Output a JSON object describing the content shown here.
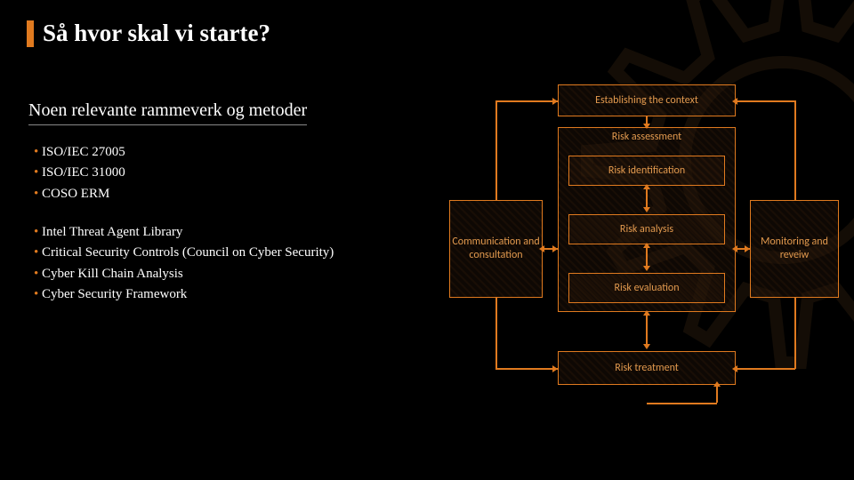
{
  "title": "Så hvor skal vi starte?",
  "subtitle": "Noen relevante rammeverk og metoder",
  "list1": [
    "ISO/IEC 27005",
    "ISO/IEC 31000",
    "COSO ERM"
  ],
  "list2": [
    "Intel Threat Agent Library",
    "Critical Security Controls (Council on Cyber Security)",
    "Cyber Kill Chain Analysis",
    "Cyber Security Framework"
  ],
  "diagram": {
    "comm": "Communication and consultation",
    "mon": "Monitoring and reveiw",
    "ctx": "Establishing the context",
    "assess": "Risk assessment",
    "ident": "Risk identification",
    "anal": "Risk analysis",
    "eval": "Risk evaluation",
    "treat": "Risk treatment"
  }
}
